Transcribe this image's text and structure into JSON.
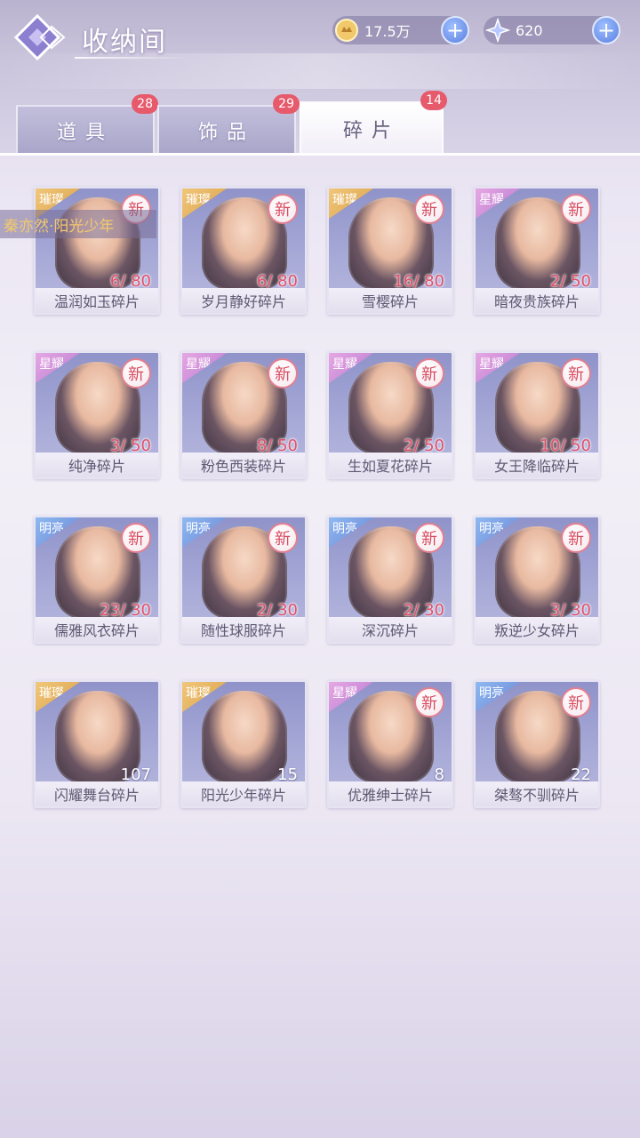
{
  "header": {
    "title": "收纳间",
    "gold_value": "17.5万",
    "star_value": "620"
  },
  "tabs": [
    {
      "label": "道具",
      "badge": "28",
      "active": false
    },
    {
      "label": "饰品",
      "badge": "29",
      "active": false
    },
    {
      "label": "碎片",
      "badge": "14",
      "active": true
    }
  ],
  "tooltip": "秦亦然·阳光少年",
  "items": [
    {
      "name": "温润如玉碎片",
      "rarity": "璀璨",
      "rarity_color": "gold",
      "new": true,
      "count": "6/ 80",
      "progress": 0.075
    },
    {
      "name": "岁月静好碎片",
      "rarity": "璀璨",
      "rarity_color": "gold",
      "new": true,
      "count": "6/ 80",
      "progress": 0.075
    },
    {
      "name": "雪樱碎片",
      "rarity": "璀璨",
      "rarity_color": "gold",
      "new": true,
      "count": "16/ 80",
      "progress": 0.2
    },
    {
      "name": "暗夜贵族碎片",
      "rarity": "星耀",
      "rarity_color": "pink",
      "new": true,
      "count": "2/ 50",
      "progress": 0.04
    },
    {
      "name": "纯净碎片",
      "rarity": "星耀",
      "rarity_color": "pink",
      "new": true,
      "count": "3/ 50",
      "progress": 0.06
    },
    {
      "name": "粉色西装碎片",
      "rarity": "星耀",
      "rarity_color": "pink",
      "new": true,
      "count": "8/ 50",
      "progress": 0.16
    },
    {
      "name": "生如夏花碎片",
      "rarity": "星耀",
      "rarity_color": "pink",
      "new": true,
      "count": "2/ 50",
      "progress": 0.04
    },
    {
      "name": "女王降临碎片",
      "rarity": "星耀",
      "rarity_color": "pink",
      "new": true,
      "count": "10/ 50",
      "progress": 0.2
    },
    {
      "name": "儒雅风衣碎片",
      "rarity": "明亮",
      "rarity_color": "blue",
      "new": true,
      "count": "23/ 30",
      "progress": 0.767
    },
    {
      "name": "随性球服碎片",
      "rarity": "明亮",
      "rarity_color": "blue",
      "new": true,
      "count": "2/ 30",
      "progress": 0.067
    },
    {
      "name": "深沉碎片",
      "rarity": "明亮",
      "rarity_color": "blue",
      "new": true,
      "count": "2/ 30",
      "progress": 0.067
    },
    {
      "name": "叛逆少女碎片",
      "rarity": "明亮",
      "rarity_color": "blue",
      "new": true,
      "count": "3/ 30",
      "progress": 0.1
    },
    {
      "name": "闪耀舞台碎片",
      "rarity": "璀璨",
      "rarity_color": "gold",
      "new": false,
      "count": "107",
      "progress": null
    },
    {
      "name": "阳光少年碎片",
      "rarity": "璀璨",
      "rarity_color": "gold",
      "new": false,
      "count": "15",
      "progress": null
    },
    {
      "name": "优雅绅士碎片",
      "rarity": "星耀",
      "rarity_color": "pink",
      "new": true,
      "count": "8",
      "progress": null
    },
    {
      "name": "桀骜不驯碎片",
      "rarity": "明亮",
      "rarity_color": "blue",
      "new": true,
      "count": "22",
      "progress": null
    }
  ],
  "new_label": "新"
}
